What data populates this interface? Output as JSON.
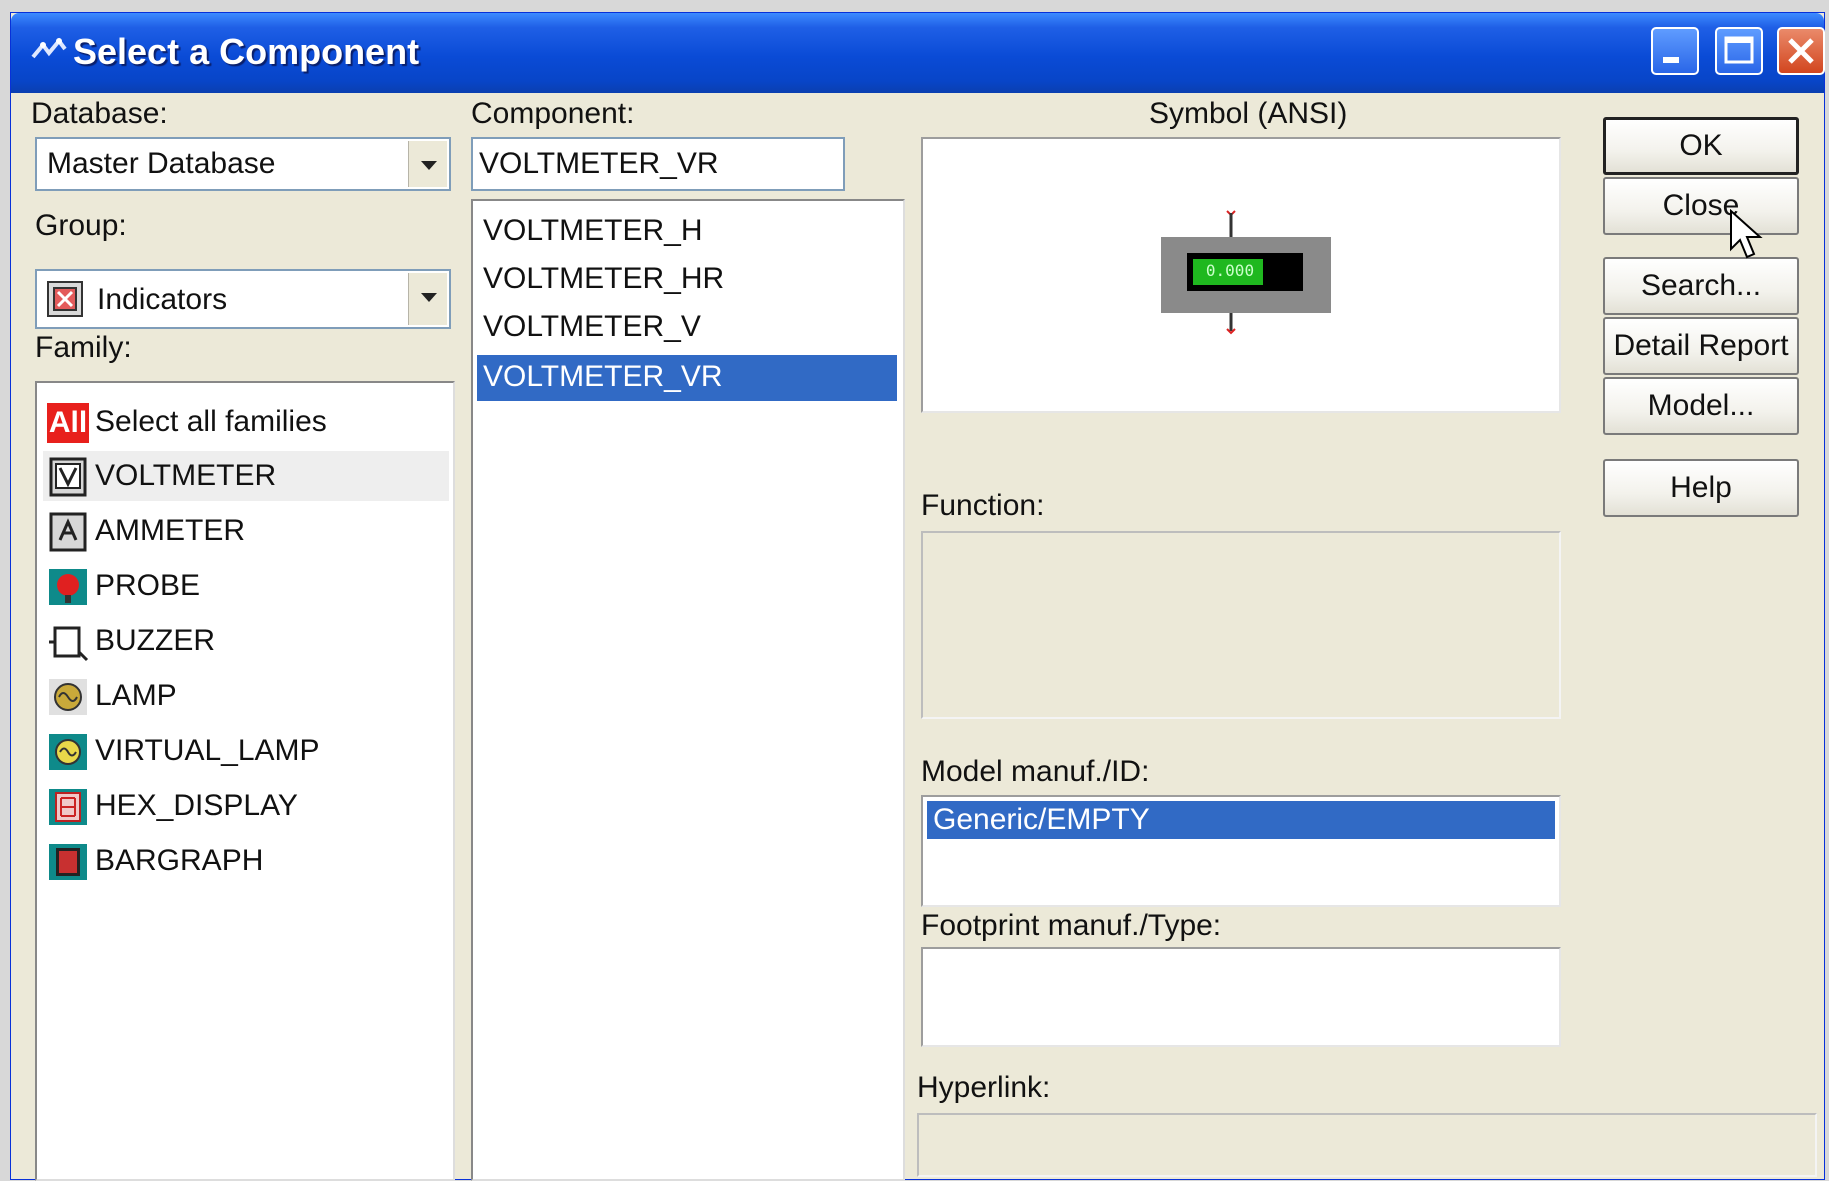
{
  "window": {
    "title": "Select a Component"
  },
  "database": {
    "label": "Database:",
    "selected": "Master Database"
  },
  "group": {
    "label": "Group:",
    "selected": "Indicators"
  },
  "family": {
    "label": "Family:",
    "items": [
      {
        "icon_text": "All",
        "label": "Select all families"
      },
      {
        "label": "VOLTMETER"
      },
      {
        "label": "AMMETER"
      },
      {
        "label": "PROBE"
      },
      {
        "label": "BUZZER"
      },
      {
        "label": "LAMP"
      },
      {
        "label": "VIRTUAL_LAMP"
      },
      {
        "label": "HEX_DISPLAY"
      },
      {
        "label": "BARGRAPH"
      }
    ]
  },
  "component": {
    "label": "Component:",
    "value": "VOLTMETER_VR",
    "items": [
      "VOLTMETER_H",
      "VOLTMETER_HR",
      "VOLTMETER_V",
      "VOLTMETER_VR"
    ],
    "selected_index": 3
  },
  "symbol": {
    "label": "Symbol (ANSI)",
    "display_text": "0.000"
  },
  "function": {
    "label": "Function:"
  },
  "model": {
    "label": "Model manuf./ID:",
    "selected": "Generic/EMPTY"
  },
  "footprint": {
    "label": "Footprint manuf./Type:"
  },
  "hyperlink": {
    "label": "Hyperlink:"
  },
  "buttons": {
    "ok": "OK",
    "close": "Close",
    "search": "Search...",
    "detail_report": "Detail Report",
    "model": "Model...",
    "help": "Help"
  },
  "colors": {
    "title_bar": "#0a4bd6",
    "selection": "#316ac5",
    "dialog_bg": "#ece9d8"
  }
}
